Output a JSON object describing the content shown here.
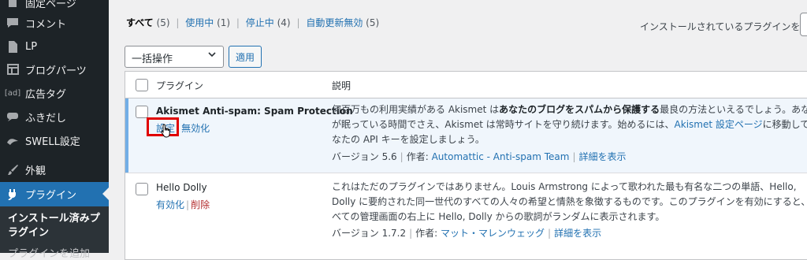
{
  "sidebar": {
    "items": [
      {
        "label": "固定ページ",
        "icon": "page-icon"
      },
      {
        "label": "コメント",
        "icon": "comment-icon"
      },
      {
        "label": "LP",
        "icon": "document-icon"
      },
      {
        "label": "ブログパーツ",
        "icon": "table-icon"
      },
      {
        "label": "広告タグ",
        "icon": "ad-icon"
      },
      {
        "label": "ふきだし",
        "icon": "speech-bubble-icon"
      },
      {
        "label": "SWELL設定",
        "icon": "swell-icon"
      },
      {
        "label": "外観",
        "icon": "brush-icon"
      },
      {
        "label": "プラグイン",
        "icon": "plugin-icon"
      }
    ],
    "submenu": {
      "current": "インストール済みプラグイン",
      "next": "プラグインを追加"
    }
  },
  "filters": {
    "all": "すべて",
    "all_count": "(5)",
    "active": "使用中",
    "active_count": "(1)",
    "inactive": "停止中",
    "inactive_count": "(4)",
    "auto_update_disabled": "自動更新無効",
    "auto_update_disabled_count": "(5)"
  },
  "search": {
    "label": "インストールされているプラグインを検索"
  },
  "bulk": {
    "selected": "一括操作",
    "apply": "適用"
  },
  "table": {
    "col_plugin": "プラグイン",
    "col_description": "説明",
    "rows": [
      {
        "name": "Akismet Anti-spam: Spam Protection",
        "action1": "設定",
        "action2": "無効化",
        "desc_pre": "何百万もの利用実績がある Akismet は",
        "desc_bold": "あなたのブログをスパムから保護する",
        "desc_post": "最良の方法といえるでしょう。あなたが眠っている時間でさえ、Akismet は常時サイトを守り続けます。始めるには、",
        "desc_link": "Akismet 設定ページ",
        "desc_end": "に移動してあなたの API キーを設定しましょう。",
        "version": "バージョン 5.6",
        "author_label": "作者:",
        "author": "Automattic - Anti-spam Team",
        "details": "詳細を表示"
      },
      {
        "name": "Hello Dolly",
        "action1": "有効化",
        "action2": "削除",
        "desc": "これはただのプラグインではありません。Louis Armstrong によって歌われた最も有名な二つの単語、Hello, Dolly に要約された同一世代のすべての人々の希望と情熱を象徴するものです。このプラグインを有効にすると、すべての管理画面の右上に Hello, Dolly からの歌詞がランダムに表示されます。",
        "version": "バージョン 1.7.2",
        "author_label": "作者:",
        "author": "マット・マレンウェッグ",
        "details": "詳細を表示"
      }
    ]
  }
}
